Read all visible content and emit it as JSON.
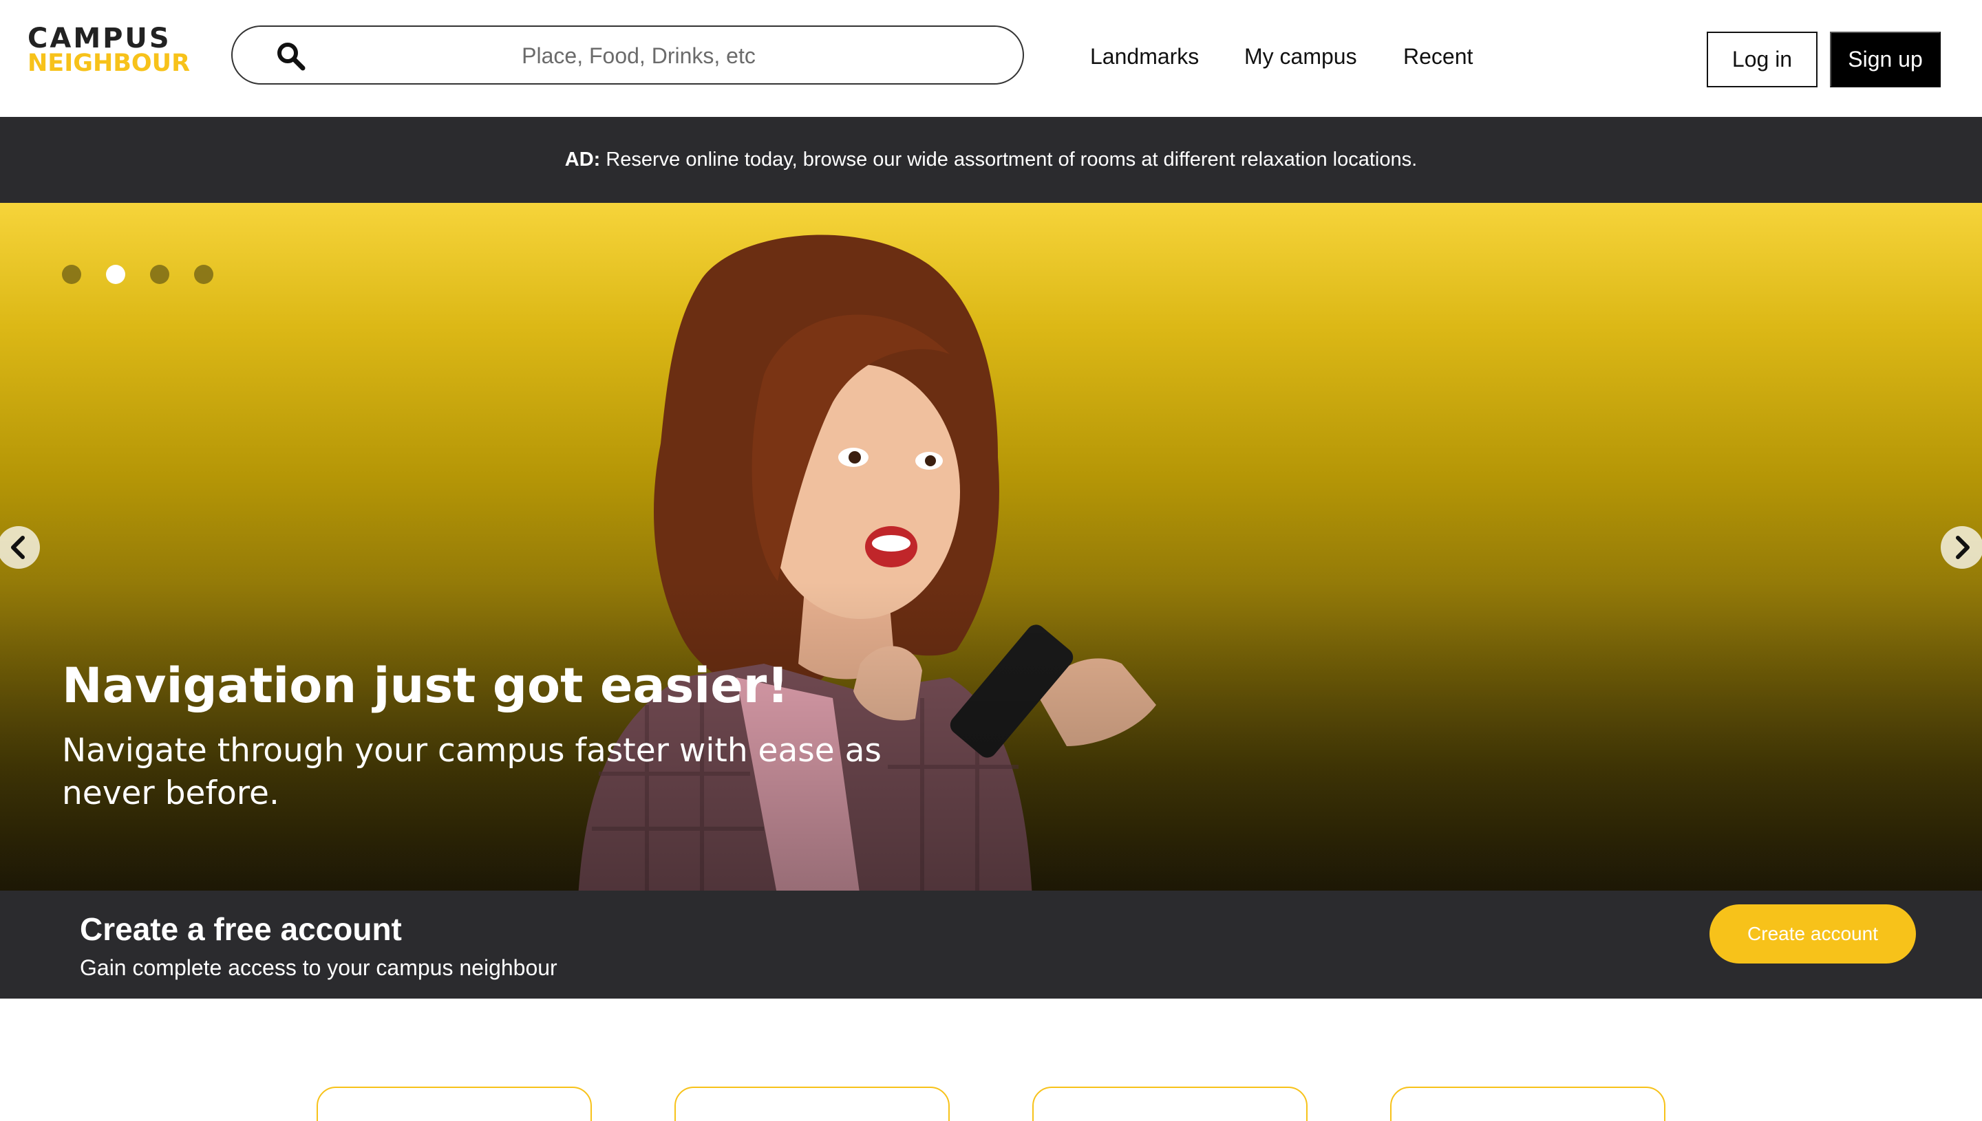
{
  "brand": {
    "logo_line1": "CAMPUS",
    "logo_line2": "NEIGHBOUR",
    "accent_color": "#f7c21a"
  },
  "search": {
    "placeholder": "Place, Food, Drinks, etc",
    "icon": "search-icon"
  },
  "nav": {
    "items": [
      {
        "label": "Landmarks"
      },
      {
        "label": "My campus"
      },
      {
        "label": "Recent"
      }
    ]
  },
  "auth": {
    "login_label": "Log in",
    "signup_label": "Sign up"
  },
  "ad": {
    "prefix": "AD:",
    "text": "Reserve online today, browse our wide assortment of rooms at different relaxation locations."
  },
  "hero": {
    "title": "Navigation just got easier!",
    "subtitle": "Navigate through your campus faster with ease as never before.",
    "slide_count": 4,
    "active_slide": 2,
    "prev_icon": "chevron-left-icon",
    "next_icon": "chevron-right-icon"
  },
  "cta": {
    "title": "Create a free account",
    "subtitle": "Gain complete access to your campus neighbour",
    "button_label": "Create account"
  },
  "cards": {
    "count": 4
  }
}
